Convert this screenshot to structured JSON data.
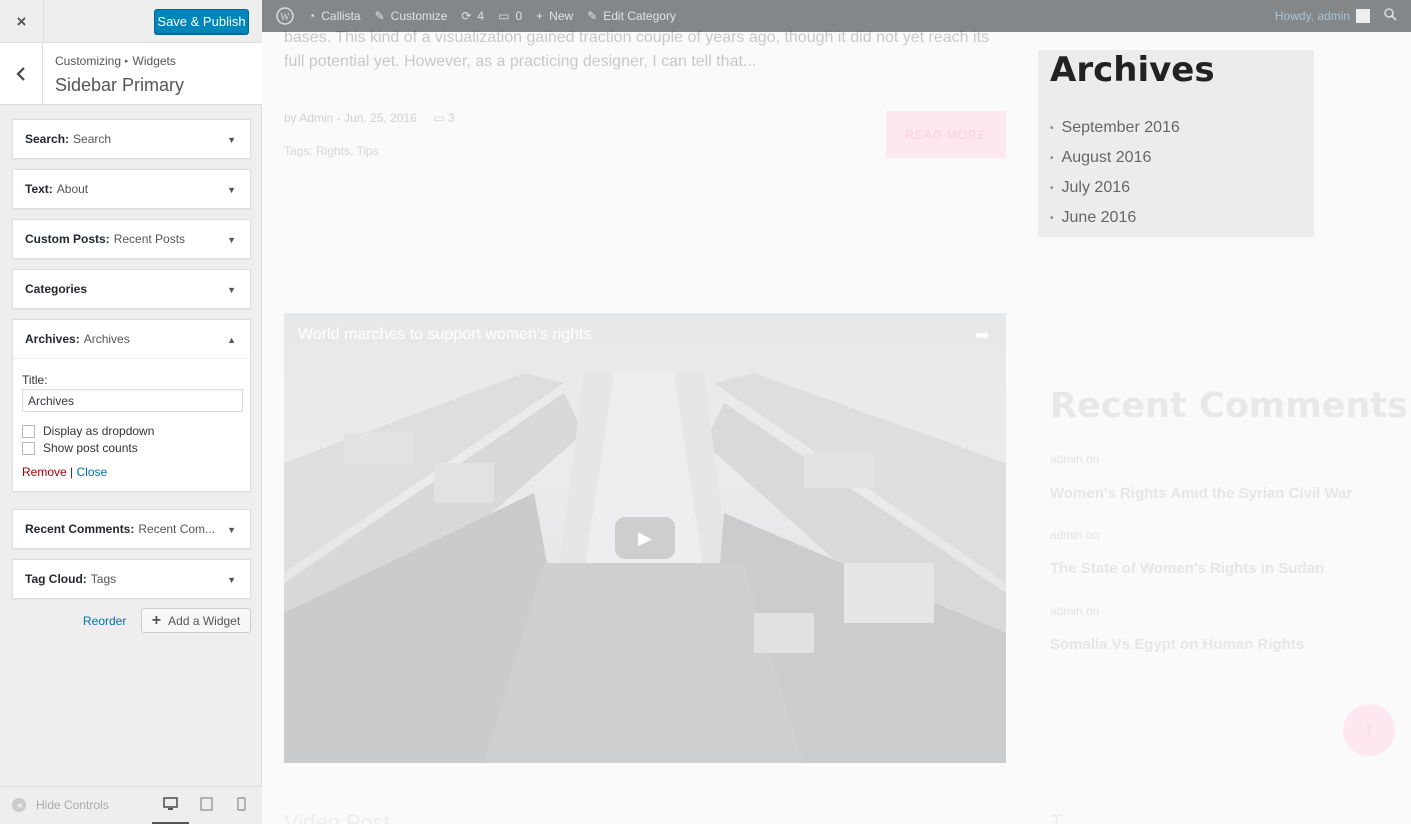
{
  "header": {
    "close_icon": "×",
    "save_label": "Save & Publish"
  },
  "section": {
    "breadcrumb_1": "Customizing",
    "breadcrumb_sep": "▸",
    "breadcrumb_2": "Widgets",
    "title": "Sidebar Primary",
    "back_icon": "‹"
  },
  "widgets": [
    {
      "type": "Search:",
      "title": "Search",
      "caret": "▼"
    },
    {
      "type": "Text:",
      "title": "About",
      "caret": "▼"
    },
    {
      "type": "Custom Posts:",
      "title": "Recent Posts",
      "caret": "▼"
    },
    {
      "type": "Categories",
      "title": "",
      "caret": "▼"
    },
    {
      "type": "Archives:",
      "title": "Archives",
      "caret": "▲"
    },
    {
      "type": "Recent Comments:",
      "title": "Recent Com...",
      "caret": "▼"
    },
    {
      "type": "Tag Cloud:",
      "title": "Tags",
      "caret": "▼"
    }
  ],
  "archives_form": {
    "title_label": "Title:",
    "title_value": "Archives",
    "dropdown_label": "Display as dropdown",
    "dropdown_checked": false,
    "counts_label": "Show post counts",
    "counts_checked": false,
    "remove_label": "Remove",
    "separator": "|",
    "close_label": "Close"
  },
  "panel_actions": {
    "reorder_label": "Reorder",
    "add_widget_label": "Add a Widget"
  },
  "footer": {
    "hide_controls_label": "Hide Controls",
    "devices": [
      "desktop-icon",
      "tablet-icon",
      "mobile-icon"
    ]
  },
  "admin_bar": {
    "site_name": "Callista",
    "customize": "Customize",
    "updates_count": "4",
    "comments_count": "0",
    "new_label": "New",
    "edit_label": "Edit Category",
    "howdy": "Howdy, admin"
  },
  "post": {
    "excerpt": "bases. This kind of a visualization gained traction couple of years ago, though it did not yet reach its full potential yet. However, as a practicing designer, I can tell that...",
    "meta": "by Admin - Jun. 25, 2016",
    "comments": "3",
    "tags": "Tags: Rights, Tips",
    "read_more": "READ MORE"
  },
  "archives_widget": {
    "title": "Archives",
    "items": [
      "September 2016",
      "August 2016",
      "July 2016",
      "June 2016"
    ]
  },
  "video": {
    "title": "World marches to support women's rights"
  },
  "recent_comments": {
    "title": "Recent Comments",
    "items": [
      {
        "meta": "admin on",
        "link": "Women's Rights Amid the Syrian Civil War"
      },
      {
        "meta": "admin on",
        "link": "The State of Women's Rights in Sudan"
      },
      {
        "meta": "admin on",
        "link": "Somalia Vs Egypt on Human Rights"
      }
    ]
  },
  "below_fold": {
    "video_post": "Video Post",
    "tags": "T"
  },
  "colors": {
    "primary_button": "#0085ba",
    "link": "#0073aa",
    "remove": "#aa0000",
    "accent_pink": "#fde8f1"
  }
}
